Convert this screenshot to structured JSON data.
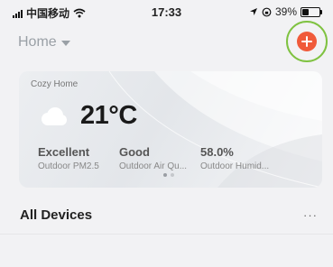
{
  "status_bar": {
    "carrier": "中国移动",
    "time": "17:33",
    "battery": "39%",
    "battery_level": 0.39
  },
  "header": {
    "home_label": "Home",
    "add_button_color": "#f05a3a",
    "highlight_ring_color": "#7fc241"
  },
  "weather_card": {
    "home_name": "Cozy Home",
    "temperature": "21°C",
    "icon": "cloud-icon",
    "stats": [
      {
        "value": "Excellent",
        "label": "Outdoor PM2.5"
      },
      {
        "value": "Good",
        "label": "Outdoor Air Qu..."
      },
      {
        "value": "58.0%",
        "label": "Outdoor Humid..."
      }
    ],
    "page_count": 2,
    "active_page": 1
  },
  "devices": {
    "title": "All Devices",
    "more_label": "···"
  }
}
